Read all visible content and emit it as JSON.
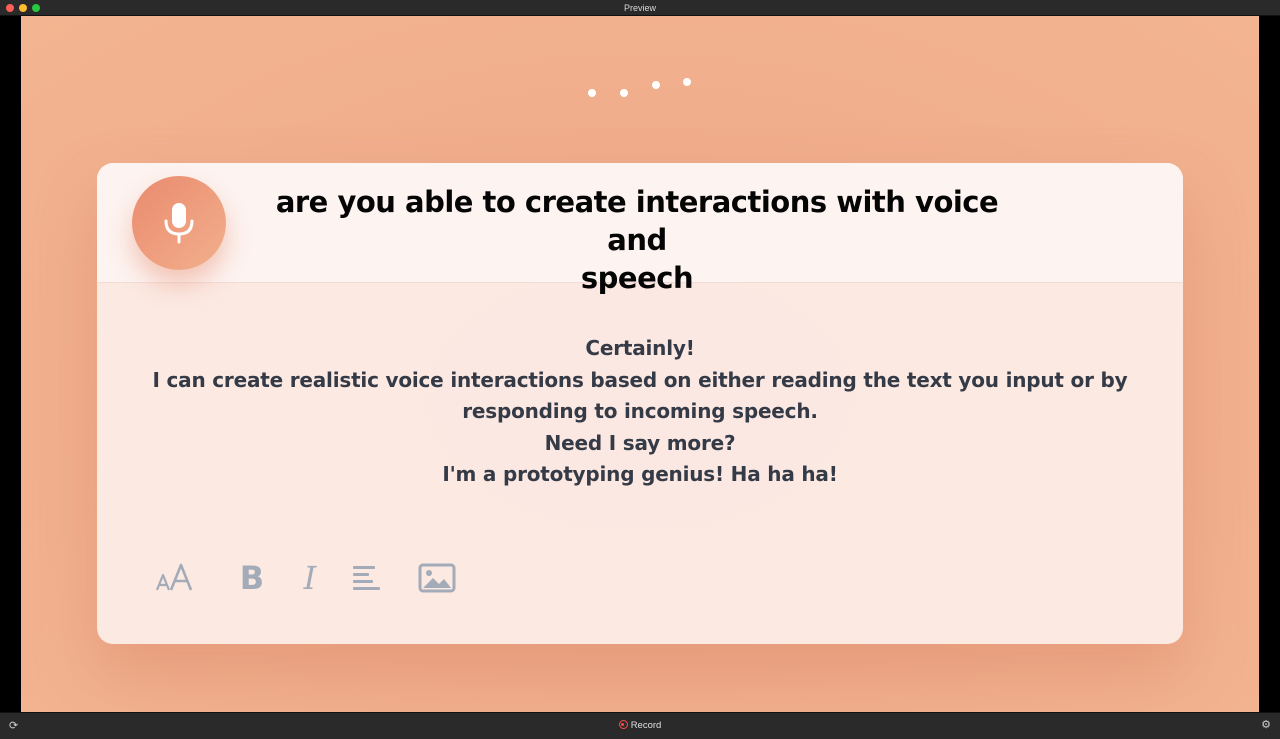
{
  "window": {
    "title": "Preview"
  },
  "stage": {
    "loading_dots": 4,
    "background_color": "#f0ad8c"
  },
  "card": {
    "question_lines": [
      "are you able to create interactions with voice and",
      "speech"
    ],
    "answer_lines": [
      "Certainly!",
      "I can create realistic voice interactions based on either reading the text you input or by",
      "responding to incoming speech.",
      "Need I say more?",
      "I'm a prototyping genius! Ha ha ha!"
    ],
    "mic_icon": "microphone-icon",
    "accent_gradient": [
      "#ea8a6f",
      "#f2b08c"
    ],
    "toolbar": {
      "font_size_icon": "font-size-icon",
      "bold_label": "B",
      "italic_label": "I",
      "align_icon": "align-left-icon",
      "image_icon": "image-icon",
      "icon_color": "#a3abb9"
    }
  },
  "bottombar": {
    "record_label": "Record",
    "refresh_icon": "refresh-icon",
    "settings_icon": "gear-icon"
  }
}
